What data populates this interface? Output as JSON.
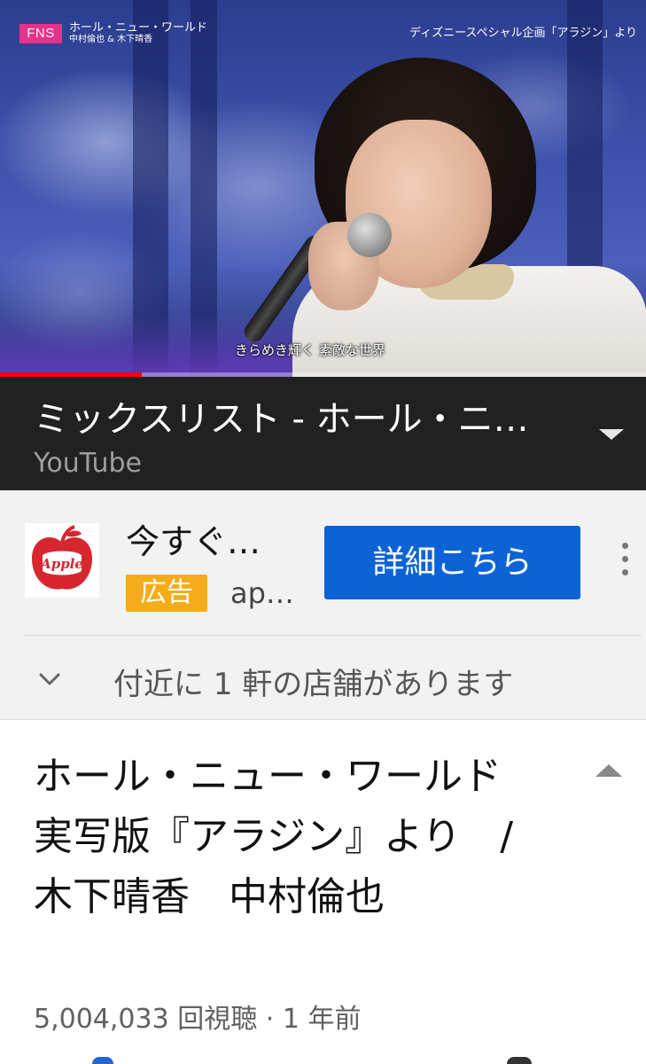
{
  "player": {
    "channel_badge": "FNS",
    "song_caption": "ホール・ニュー・ワールド",
    "song_performers": "中村倫也 & 木下晴香",
    "program_caption": "ディズニースペシャル企画「アラジン」より",
    "lyric_subtitle": "きらめき輝く 素敵な世界",
    "progress_fraction": 0.22,
    "progress_color": "#ff0000"
  },
  "mini_header": {
    "title": "ミックスリスト - ホール・ニュー・ワールド",
    "subtitle": "YouTube",
    "expand_icon": "caret-down-icon"
  },
  "ad": {
    "logo_text": "Apple",
    "title": "今すぐ…",
    "badge": "広告",
    "advertiser": "ap…",
    "cta_label": "詳細こちら",
    "cta_color": "#0b63d6",
    "badge_color": "#f5ac1b",
    "menu_icon": "more-vert-icon",
    "store_notice": "付近に 1 軒の店舗があります",
    "store_expand_icon": "chevron-down-icon"
  },
  "video": {
    "title": "ホール・ニュー・ワールド　実写版『アラジン』より　/　木下晴香　中村倫也",
    "meta": "5,004,033 回視聴 · 1 年前",
    "collapse_icon": "caret-up-icon"
  }
}
